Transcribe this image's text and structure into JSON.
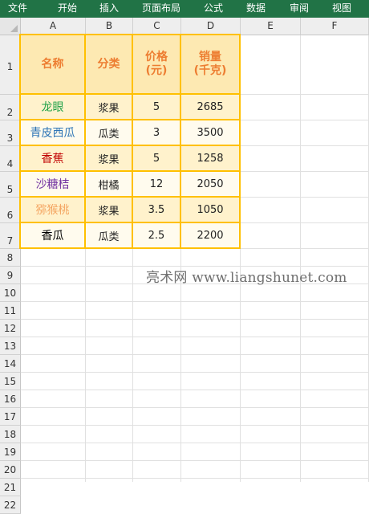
{
  "ribbon": {
    "tabs": [
      "文件",
      "开始",
      "插入",
      "页面布局",
      "公式",
      "数据",
      "审阅",
      "视图"
    ]
  },
  "columns": [
    "A",
    "B",
    "C",
    "D",
    "E",
    "F"
  ],
  "rows": [
    "1",
    "2",
    "3",
    "4",
    "5",
    "6",
    "7",
    "8",
    "9",
    "10",
    "11",
    "12",
    "13",
    "14",
    "15",
    "16",
    "17",
    "18",
    "19",
    "20",
    "21",
    "22"
  ],
  "table": {
    "headers": [
      "名称",
      "分类",
      "价格\n(元)",
      "销量\n(千克)"
    ],
    "rows": [
      {
        "name": "龙眼",
        "name_color": "#22a24a",
        "category": "浆果",
        "price": "5",
        "sales": "2685"
      },
      {
        "name": "青皮西瓜",
        "name_color": "#2e75b6",
        "category": "瓜类",
        "price": "3",
        "sales": "3500"
      },
      {
        "name": "香蕉",
        "name_color": "#c00000",
        "category": "浆果",
        "price": "5",
        "sales": "1258"
      },
      {
        "name": "沙糖桔",
        "name_color": "#7030a0",
        "category": "柑橘",
        "price": "12",
        "sales": "2050"
      },
      {
        "name": "猕猴桃",
        "name_color": "#f4a460",
        "category": "浆果",
        "price": "3.5",
        "sales": "1050"
      },
      {
        "name": "香瓜",
        "name_color": "#000000",
        "category": "瓜类",
        "price": "2.5",
        "sales": "2200"
      }
    ]
  },
  "watermark": "亮术网 www.liangshunet.com",
  "colors": {
    "ribbon_bg": "#217346",
    "header_fill": "#fde9b2",
    "header_text": "#ed7d31",
    "cell_fill": "#fff2cc",
    "border": "#ffc000"
  }
}
